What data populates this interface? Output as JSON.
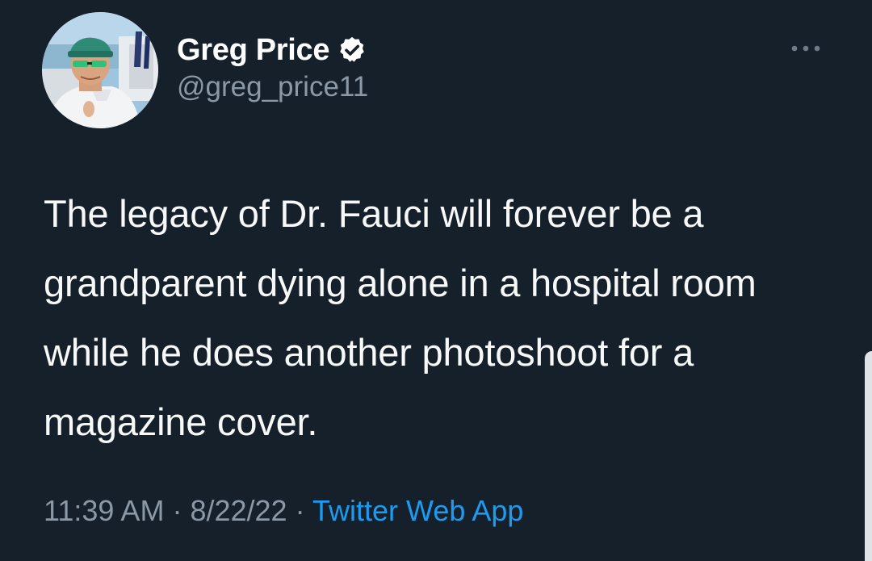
{
  "tweet": {
    "author": {
      "display_name": "Greg Price",
      "handle": "@greg_price11",
      "verified": true
    },
    "text": "The legacy of Dr. Fauci will forever be a grandparent dying alone in a hospital room while he does another photoshoot for a magazine cover.",
    "time": "11:39 AM",
    "separator": "·",
    "date": "8/22/22",
    "source": "Twitter Web App"
  },
  "icons": {
    "verified": "verified-badge-icon",
    "more": "more-options-icon"
  },
  "colors": {
    "background": "#15202b",
    "primary_text": "#ffffff",
    "secondary_text": "#8b98a5",
    "link": "#1d9bf0"
  }
}
